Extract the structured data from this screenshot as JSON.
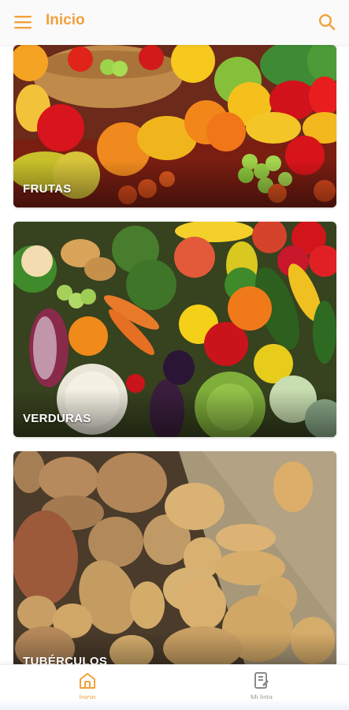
{
  "app_bar": {
    "title": "Inicio",
    "menu_icon": "menu-icon",
    "search_icon": "search-icon",
    "accent": "#f2a13a"
  },
  "categories": [
    {
      "label": "FRUTAS"
    },
    {
      "label": "VERDURAS"
    },
    {
      "label": "TUBÉRCULOS"
    }
  ],
  "bottom_nav": {
    "items": [
      {
        "label": "Inicio",
        "icon": "home-icon",
        "active": true
      },
      {
        "label": "Mi lista",
        "icon": "list-icon",
        "active": false
      }
    ],
    "active_color": "#f2a13a",
    "inactive_color": "#9e9e9e"
  }
}
